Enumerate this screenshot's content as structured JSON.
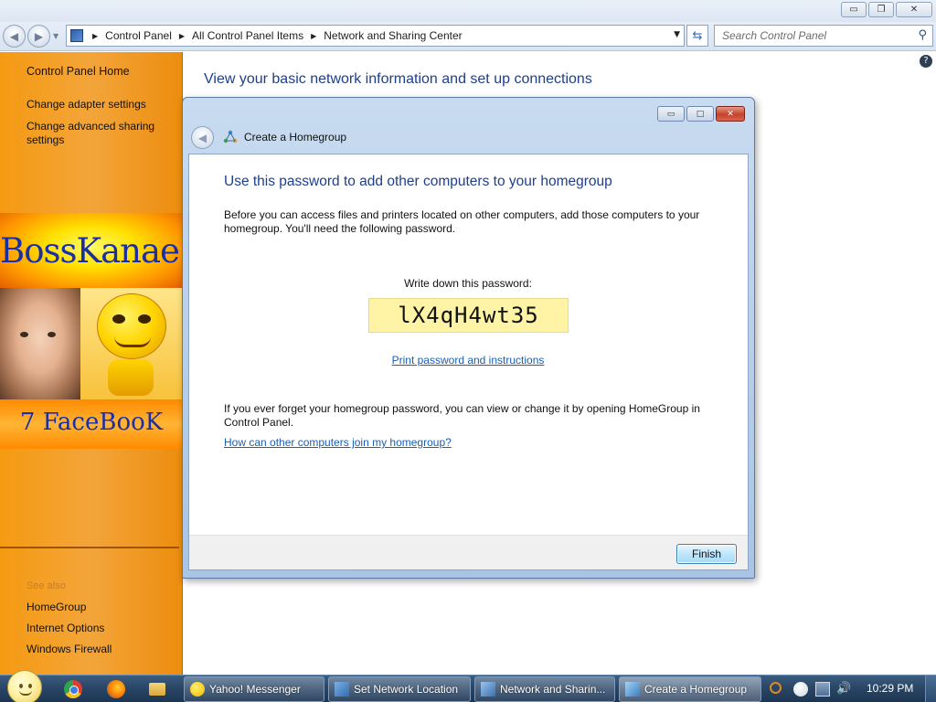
{
  "window": {
    "minimize_glyph": "▭",
    "restore_glyph": "❐",
    "close_glyph": "✕"
  },
  "address": {
    "crumbs": [
      "Control Panel",
      "All Control Panel Items",
      "Network and Sharing Center"
    ],
    "search_placeholder": "Search Control Panel"
  },
  "sidebar": {
    "home": "Control Panel Home",
    "adapter": "Change adapter settings",
    "advanced": "Change advanced sharing settings",
    "see_also": "See also",
    "homegroup": "HomeGroup",
    "internet_options": "Internet Options",
    "firewall": "Windows Firewall"
  },
  "banner": {
    "name": "BossKanae",
    "facebook": "7 FaceBooK"
  },
  "main": {
    "title": "View your basic network information and set up connections"
  },
  "dialog": {
    "title": "Create a Homegroup",
    "heading": "Use this password to add other computers to your homegroup",
    "intro": "Before you can access files and printers located on other computers, add those computers to your homegroup. You'll need the following password.",
    "write_down": "Write down this password:",
    "password": "lX4qH4wt35",
    "print_link": "Print password and instructions",
    "forget_text": "If you ever forget your homegroup password, you can view or change it by opening HomeGroup in Control Panel.",
    "join_link": "How can other computers join my homegroup?",
    "finish": "Finish"
  },
  "taskbar": {
    "tasks": [
      {
        "label": "Yahoo! Messenger",
        "icon": "yahoo-messenger-icon"
      },
      {
        "label": "Set Network Location",
        "icon": "network-icon"
      },
      {
        "label": "Network and Sharin...",
        "icon": "network-sharing-icon"
      },
      {
        "label": "Create a Homegroup",
        "icon": "homegroup-icon"
      }
    ],
    "clock": "10:29 PM"
  },
  "colors": {
    "sidebar_orange": "#f59a12",
    "link_blue": "#1a5fb4",
    "heading_blue": "#1e3f8a",
    "password_bg": "#fff3a6"
  }
}
